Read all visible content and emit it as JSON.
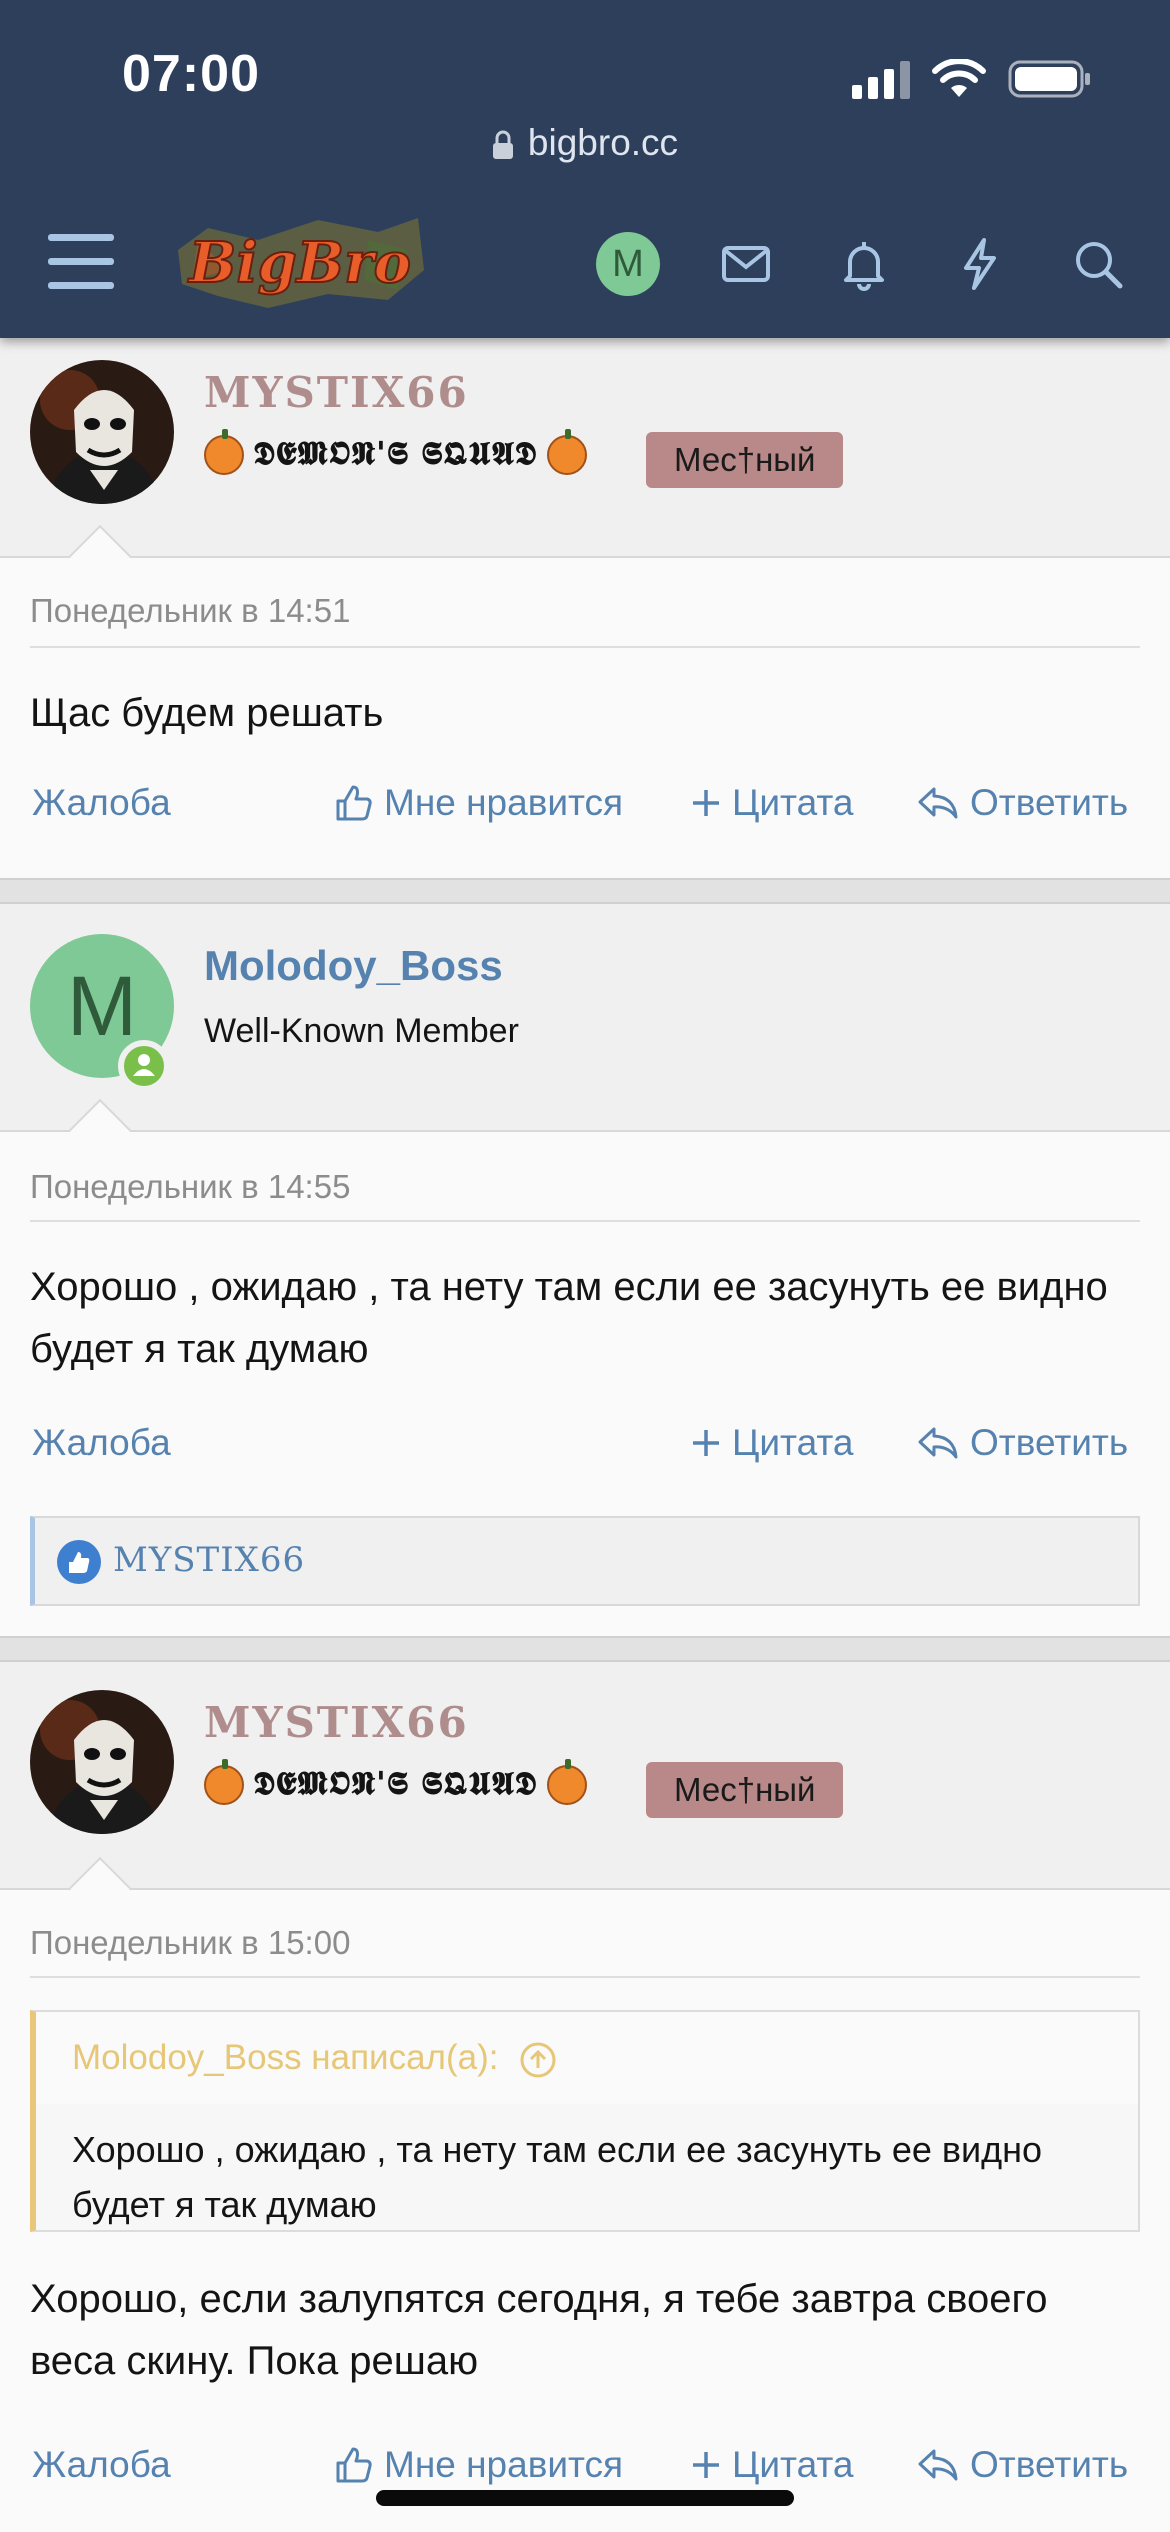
{
  "status_bar": {
    "time": "07:00"
  },
  "browser": {
    "url": "bigbro.cc"
  },
  "nav": {
    "logo_text": "BigBro",
    "avatar_letter": "M",
    "icons": [
      "menu-icon",
      "mail-icon",
      "bell-icon",
      "lightning-icon",
      "search-icon"
    ]
  },
  "posts": [
    {
      "username": "MYSTIX66",
      "user_title": "𝕯𝕰𝕸𝕺𝕹'𝕾 𝕾𝕼𝖀𝕬𝕯",
      "badge": "Мес†ный",
      "date": "Понедельник в 14:51",
      "body": "Щас будем решать",
      "actions": {
        "report": "Жалоба",
        "like": "Мне нравится",
        "quote": "Цитата",
        "reply": "Ответить"
      }
    },
    {
      "username": "Molodoy_Boss",
      "avatar_letter": "M",
      "user_title": "Well-Known Member",
      "date": "Понедельник в 14:55",
      "body": "Хорошо , ожидаю , та нету там если ее засунуть ее видно будет я так думаю",
      "actions": {
        "report": "Жалоба",
        "quote": "Цитата",
        "reply": "Ответить"
      },
      "reactions": {
        "user": "MYSTIX66"
      }
    },
    {
      "username": "MYSTIX66",
      "user_title": "𝕯𝕰𝕸𝕺𝕹'𝕾 𝕾𝕼𝖀𝕬𝕯",
      "badge": "Мес†ный",
      "date": "Понедельник в 15:00",
      "quote": {
        "author": "Molodoy_Boss написал(а):",
        "text": "Хорошо , ожидаю , та нету там если ее засунуть ее видно будет я так думаю"
      },
      "body": "Хорошо, если залупятся сегодня, я тебе завтра своего веса скину. Пока решаю",
      "actions": {
        "report": "Жалоба",
        "like": "Мне нравится",
        "quote": "Цитата",
        "reply": "Ответить"
      }
    }
  ],
  "colors": {
    "header_bg": "#2e3f5c",
    "link": "#5682b0",
    "badge_bg": "#b98888",
    "quote_accent": "#e8c878",
    "online": "#7bbf4b"
  }
}
